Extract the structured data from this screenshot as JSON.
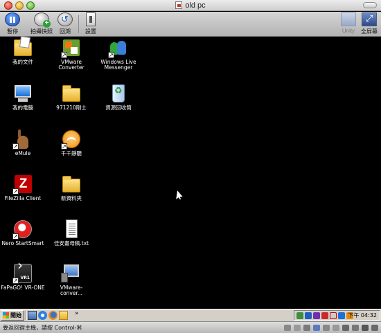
{
  "window": {
    "title": "old pc",
    "buttons": [
      "close",
      "minimize",
      "zoom"
    ]
  },
  "toolbar": {
    "pause_label": "暫停",
    "snapshot_label": "拍攝快照",
    "revert_label": "回溯",
    "settings_label": "設置",
    "unity_label": "Unity",
    "fullscreen_label": "全屏幕"
  },
  "desktop": {
    "icons": [
      {
        "label": "我的文件",
        "icon": "documents-folder-icon",
        "shortcut": false
      },
      {
        "label": "VMware Converter",
        "icon": "vmware-converter-icon",
        "shortcut": true
      },
      {
        "label": "Windows Live Messenger",
        "icon": "messenger-icon",
        "shortcut": true
      },
      {
        "label": "我的電腦",
        "icon": "computer-icon",
        "shortcut": false
      },
      {
        "label": "971210剛士",
        "icon": "folder-icon",
        "shortcut": false
      },
      {
        "label": "資源回收筒",
        "icon": "recycle-bin-icon",
        "shortcut": false
      },
      {
        "label": "eMule",
        "icon": "emule-icon",
        "shortcut": true
      },
      {
        "label": "千千靜聽",
        "icon": "ttplayer-icon",
        "shortcut": true
      },
      {
        "label": "FileZilla Client",
        "icon": "filezilla-icon",
        "shortcut": true
      },
      {
        "label": "新資料夾",
        "icon": "folder-icon",
        "shortcut": false
      },
      {
        "label": "Nero StartSmart",
        "icon": "nero-icon",
        "shortcut": true
      },
      {
        "label": "佳安畫母稿.txt",
        "icon": "text-file-icon",
        "shortcut": false
      },
      {
        "label": "FaPaGO! VR-ONE",
        "icon": "fapago-icon",
        "shortcut": true
      },
      {
        "label": "VMware-conver...",
        "icon": "vmware-installer-icon",
        "shortcut": false
      }
    ]
  },
  "taskbar": {
    "start_label": "開始",
    "quicklaunch_more": "»",
    "clock": "下午 04:32"
  },
  "statusbar": {
    "message": "要返回宿主機，請按 Control-⌘"
  }
}
